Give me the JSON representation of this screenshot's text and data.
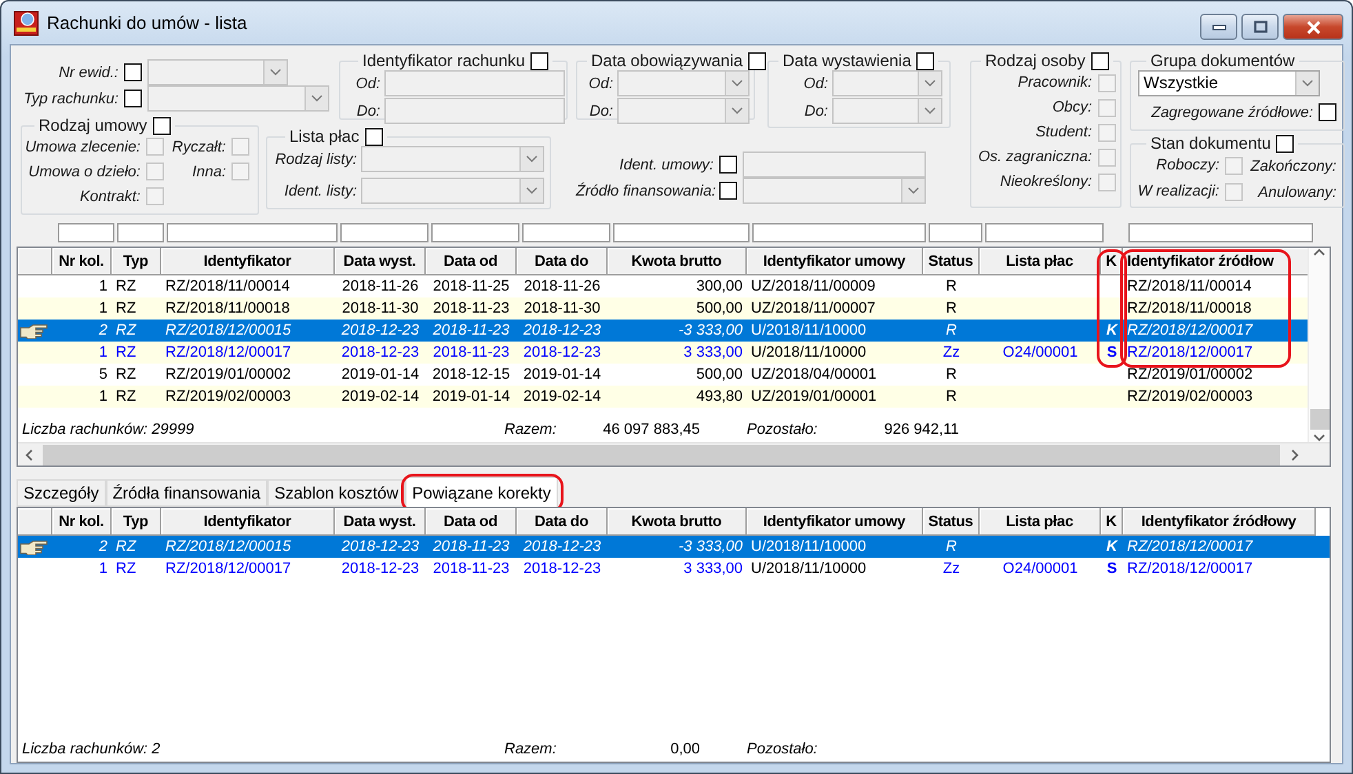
{
  "window": {
    "title": "Rachunki do umów - lista"
  },
  "filters": {
    "nr_ewid": {
      "kind": "dropdown",
      "label": "Nr ewid.:",
      "checked": false,
      "disabled": true
    },
    "typ_rachunku": {
      "kind": "dropdown",
      "label": "Typ rachunku:",
      "checked": false,
      "disabled": true
    },
    "identyfikator_rachunku": {
      "title": "Identyfikator rachunku",
      "checked": false,
      "fields": [
        {
          "kind": "text",
          "label": "Od:",
          "disabled": true
        },
        {
          "kind": "text",
          "label": "Do:",
          "disabled": true
        }
      ]
    },
    "data_obowiazywania": {
      "title": "Data obowiązywania",
      "checked": false,
      "fields": [
        {
          "kind": "dropdown",
          "label": "Od:",
          "disabled": true
        },
        {
          "kind": "dropdown",
          "label": "Do:",
          "disabled": true
        }
      ]
    },
    "data_wystawienia": {
      "title": "Data wystawienia",
      "checked": false,
      "fields": [
        {
          "kind": "dropdown",
          "label": "Od:",
          "disabled": true
        },
        {
          "kind": "dropdown",
          "label": "Do:",
          "disabled": true
        }
      ]
    },
    "rodzaj_umowy": {
      "title": "Rodzaj umowy",
      "checked": false,
      "fields": [
        {
          "kind": "checkbox",
          "label": "Umowa zlecenie:",
          "checked": false,
          "disabled": true
        },
        {
          "kind": "checkbox",
          "label": "Ryczałt:",
          "checked": false,
          "disabled": true
        },
        {
          "kind": "checkbox",
          "label": "Umowa o dzieło:",
          "checked": false,
          "disabled": true
        },
        {
          "kind": "checkbox",
          "label": "Inna:",
          "checked": false,
          "disabled": true
        },
        {
          "kind": "checkbox",
          "label": "Kontrakt:",
          "checked": false,
          "disabled": true
        }
      ]
    },
    "lista_plac": {
      "title": "Lista płac",
      "checked": false,
      "fields": [
        {
          "kind": "dropdown",
          "label": "Rodzaj listy:",
          "disabled": true
        },
        {
          "kind": "dropdown",
          "label": "Ident. listy:",
          "disabled": true
        }
      ]
    },
    "ident_umowy": {
      "kind": "text",
      "label": "Ident. umowy:",
      "checked": false,
      "disabled": true
    },
    "zrodlo_finansowania": {
      "kind": "dropdown",
      "label": "Źródło finansowania:",
      "checked": false,
      "disabled": true
    },
    "rodzaj_osoby": {
      "title": "Rodzaj osoby",
      "checked": false,
      "fields": [
        {
          "kind": "checkbox",
          "label": "Pracownik:",
          "checked": false,
          "disabled": true
        },
        {
          "kind": "checkbox",
          "label": "Obcy:",
          "checked": false,
          "disabled": true
        },
        {
          "kind": "checkbox",
          "label": "Student:",
          "checked": false,
          "disabled": true
        },
        {
          "kind": "checkbox",
          "label": "Os. zagraniczna:",
          "checked": false,
          "disabled": true
        },
        {
          "kind": "checkbox",
          "label": "Nieokreślony:",
          "checked": false,
          "disabled": true
        }
      ]
    },
    "grupa_dokumentow": {
      "title": "Grupa dokumentów",
      "fields": [
        {
          "kind": "dropdown",
          "value": "Wszystkie",
          "disabled": false
        },
        {
          "kind": "checkbox",
          "label": "Zagregowane źródłowe:",
          "checked": false,
          "disabled": false
        }
      ]
    },
    "stan_dokumentu": {
      "title": "Stan dokumentu",
      "checked": false,
      "fields": [
        {
          "kind": "checkbox",
          "label": "Roboczy:",
          "checked": false,
          "disabled": true
        },
        {
          "kind": "label",
          "label": "Zakończony:"
        },
        {
          "kind": "checkbox",
          "label": "W realizacji:",
          "checked": false,
          "disabled": true
        },
        {
          "kind": "label",
          "label": "Anulowany:"
        }
      ]
    }
  },
  "results": {
    "striped": true,
    "columns": [
      {
        "title": "Nr kol.",
        "filter": true
      },
      {
        "title": "Typ",
        "filter": true
      },
      {
        "title": "Identyfikator",
        "filter": true
      },
      {
        "title": "Data wyst.",
        "filter": true
      },
      {
        "title": "Data od",
        "filter": true
      },
      {
        "title": "Data do",
        "filter": true
      },
      {
        "title": "Kwota brutto",
        "filter": true
      },
      {
        "title": "Identyfikator umowy",
        "filter": true
      },
      {
        "title": "Status",
        "filter": true
      },
      {
        "title": "Lista płac",
        "filter": true
      },
      {
        "title": "K",
        "filter": false,
        "circled": true
      },
      {
        "title": "Identyfikator źródłow",
        "filter": true,
        "circled": true
      }
    ],
    "rows": [
      {
        "cells": [
          "1",
          "RZ",
          "RZ/2018/11/00014",
          "2018-11-26",
          "2018-11-25",
          "2018-11-26",
          "300,00",
          "UZ/2018/11/00009",
          "R",
          null,
          null,
          "RZ/2018/11/00014"
        ],
        "selected": false,
        "color": "#000000",
        "circled": true
      },
      {
        "cells": [
          "1",
          "RZ",
          "RZ/2018/11/00018",
          "2018-11-30",
          "2018-11-23",
          "2018-11-30",
          "500,00",
          "UZ/2018/11/00007",
          "R",
          null,
          null,
          "RZ/2018/11/00018"
        ],
        "selected": false,
        "color": "#000000",
        "circled": true
      },
      {
        "cells": [
          "2",
          "RZ",
          "RZ/2018/12/00015",
          "2018-12-23",
          "2018-11-23",
          "2018-12-23",
          "-3 333,00",
          "U/2018/11/10000",
          "R",
          null,
          "K",
          "RZ/2018/12/00017"
        ],
        "selected": true,
        "circled": true
      },
      {
        "cells": [
          "1",
          "RZ",
          "RZ/2018/12/00017",
          "2018-12-23",
          "2018-11-23",
          "2018-12-23",
          "3 333,00",
          "U/2018/11/10000",
          "Zz",
          "O24/00001",
          "S",
          "RZ/2018/12/00017"
        ],
        "selected": false,
        "color": "#0000ff",
        "circled": true
      },
      {
        "cells": [
          "5",
          "RZ",
          "RZ/2019/01/00002",
          "2019-01-14",
          "2018-12-15",
          "2019-01-14",
          "500,00",
          "UZ/2018/04/00001",
          "R",
          null,
          null,
          "RZ/2019/01/00002"
        ],
        "selected": false,
        "color": "#000000",
        "circled": false
      },
      {
        "cells": [
          "1",
          "RZ",
          "RZ/2019/02/00003",
          "2019-02-14",
          "2019-01-14",
          "2019-02-14",
          "493,80",
          "UZ/2019/01/00001",
          "R",
          null,
          null,
          "RZ/2019/02/00003"
        ],
        "selected": false,
        "color": "#000000",
        "circled": false
      }
    ],
    "footer": {
      "count": "Liczba rachunków: 29999",
      "total_label": "Razem:",
      "total": "46 097 883,45",
      "remaining_label": "Pozostało:",
      "remaining": "926 942,11"
    }
  },
  "tabs": [
    {
      "label": "Szczegóły",
      "selected": false,
      "circled": false
    },
    {
      "label": "Źródła finansowania",
      "selected": false,
      "circled": false
    },
    {
      "label": "Szablon kosztów",
      "selected": false,
      "circled": false
    },
    {
      "label": "Powiązane korekty",
      "selected": true,
      "circled": true
    }
  ],
  "related": {
    "striped": false,
    "columns": [
      {
        "title": "Nr kol."
      },
      {
        "title": "Typ"
      },
      {
        "title": "Identyfikator"
      },
      {
        "title": "Data wyst."
      },
      {
        "title": "Data od"
      },
      {
        "title": "Data do"
      },
      {
        "title": "Kwota brutto"
      },
      {
        "title": "Identyfikator umowy"
      },
      {
        "title": "Status"
      },
      {
        "title": "Lista płac"
      },
      {
        "title": "K"
      },
      {
        "title": "Identyfikator źródłowy"
      }
    ],
    "rows": [
      {
        "cells": [
          "2",
          "RZ",
          "RZ/2018/12/00015",
          "2018-12-23",
          "2018-11-23",
          "2018-12-23",
          "-3 333,00",
          "U/2018/11/10000",
          "R",
          null,
          "K",
          "RZ/2018/12/00017"
        ],
        "selected": true
      },
      {
        "cells": [
          "1",
          "RZ",
          "RZ/2018/12/00017",
          "2018-12-23",
          "2018-11-23",
          "2018-12-23",
          "3 333,00",
          "U/2018/11/10000",
          "Zz",
          "O24/00001",
          "S",
          "RZ/2018/12/00017"
        ],
        "selected": false,
        "color": "#0000ff"
      }
    ],
    "footer": {
      "count": "Liczba rachunków: 2",
      "total_label": "Razem:",
      "total": "0,00",
      "remaining_label": "Pozostało:"
    }
  }
}
